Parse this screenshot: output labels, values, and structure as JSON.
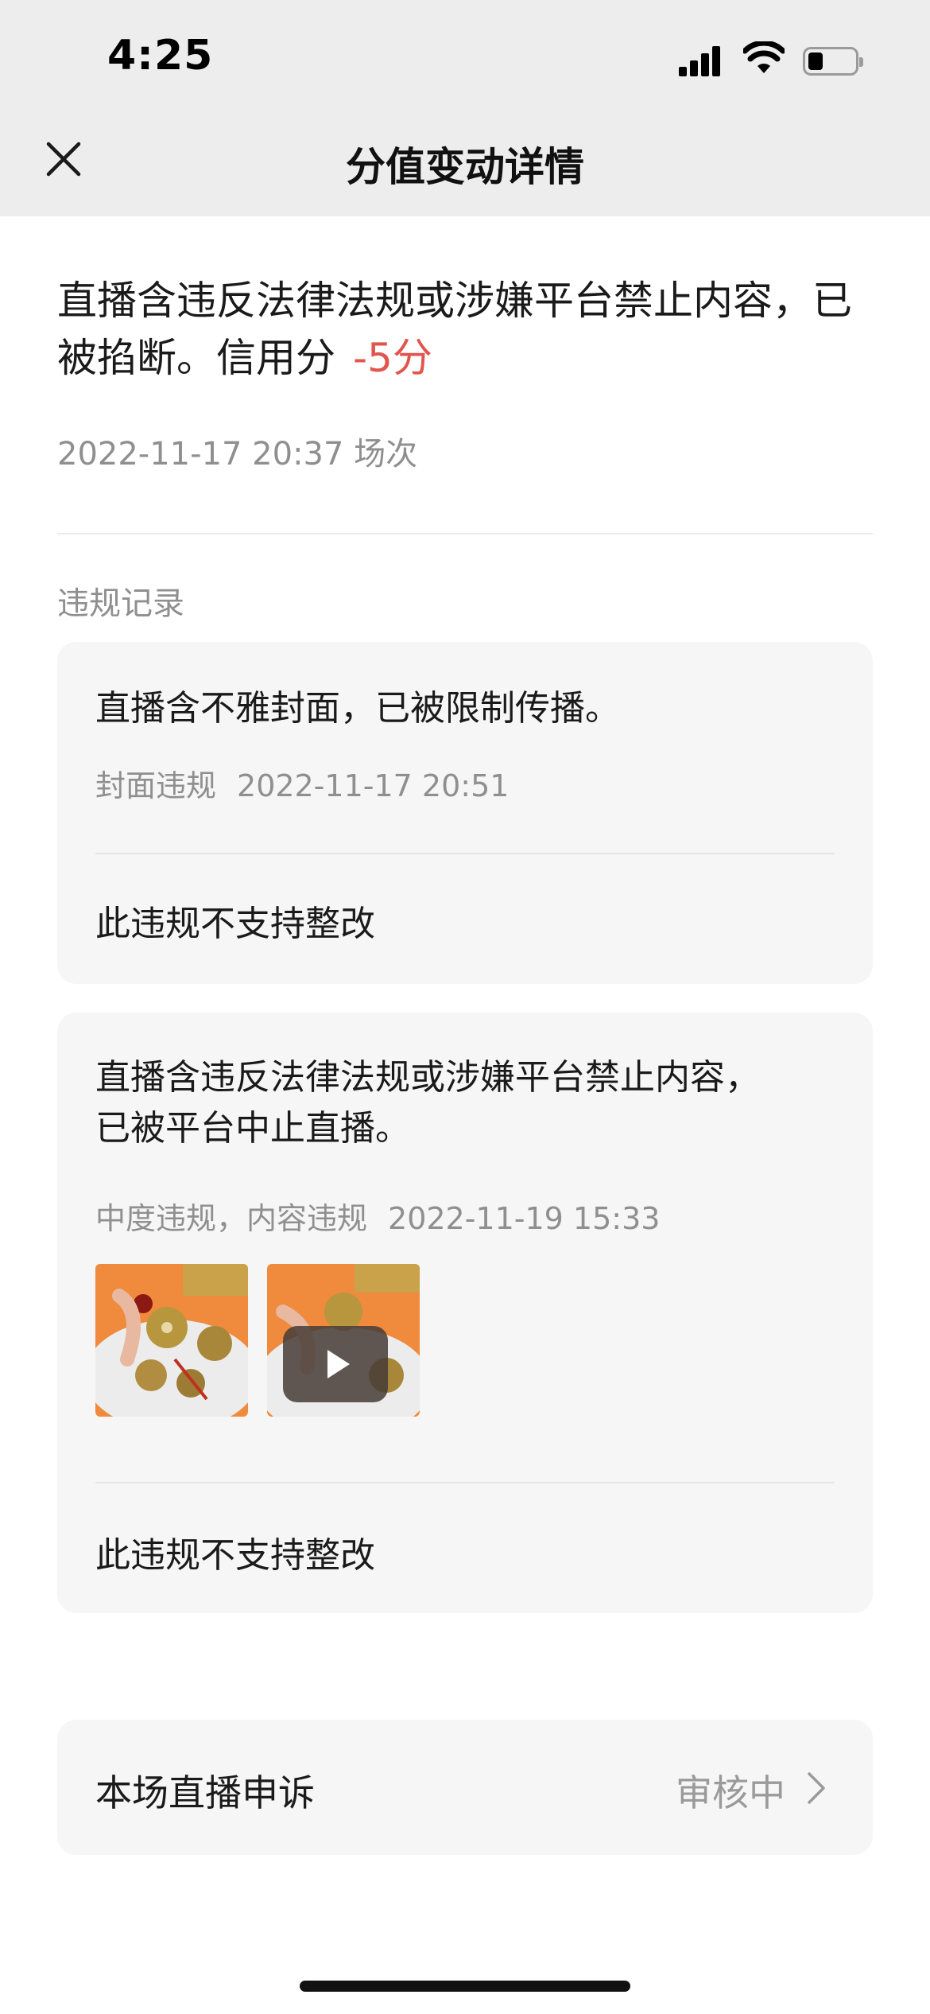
{
  "status_bar": {
    "time": "4:25"
  },
  "nav": {
    "title": "分值变动详情",
    "close_icon": "close-icon"
  },
  "summary": {
    "text": "直播含违反法律法规或涉嫌平台禁止内容，已被掐断。信用分",
    "score": "-5分",
    "meta": "2022-11-17 20:37 场次"
  },
  "records": {
    "label": "违规记录",
    "items": [
      {
        "title": "直播含不雅封面，已被限制传播。",
        "type": "封面违规",
        "time": "2022-11-17 20:51",
        "footer": "此违规不支持整改"
      },
      {
        "title": "直播含违反法律法规或涉嫌平台禁止内容，已被平台中止直播。",
        "type": "中度违规，内容违规",
        "time": "2022-11-19 15:33",
        "footer": "此违规不支持整改",
        "media": [
          "image-thumbnail",
          "video-thumbnail"
        ]
      }
    ]
  },
  "appeal": {
    "label": "本场直播申诉",
    "status": "审核中",
    "icon": "chevron-right-icon"
  },
  "colors": {
    "score_red": "#e0564e",
    "muted": "#8f8f8f",
    "card_bg": "#f6f6f6",
    "header_bg": "#ededed"
  }
}
